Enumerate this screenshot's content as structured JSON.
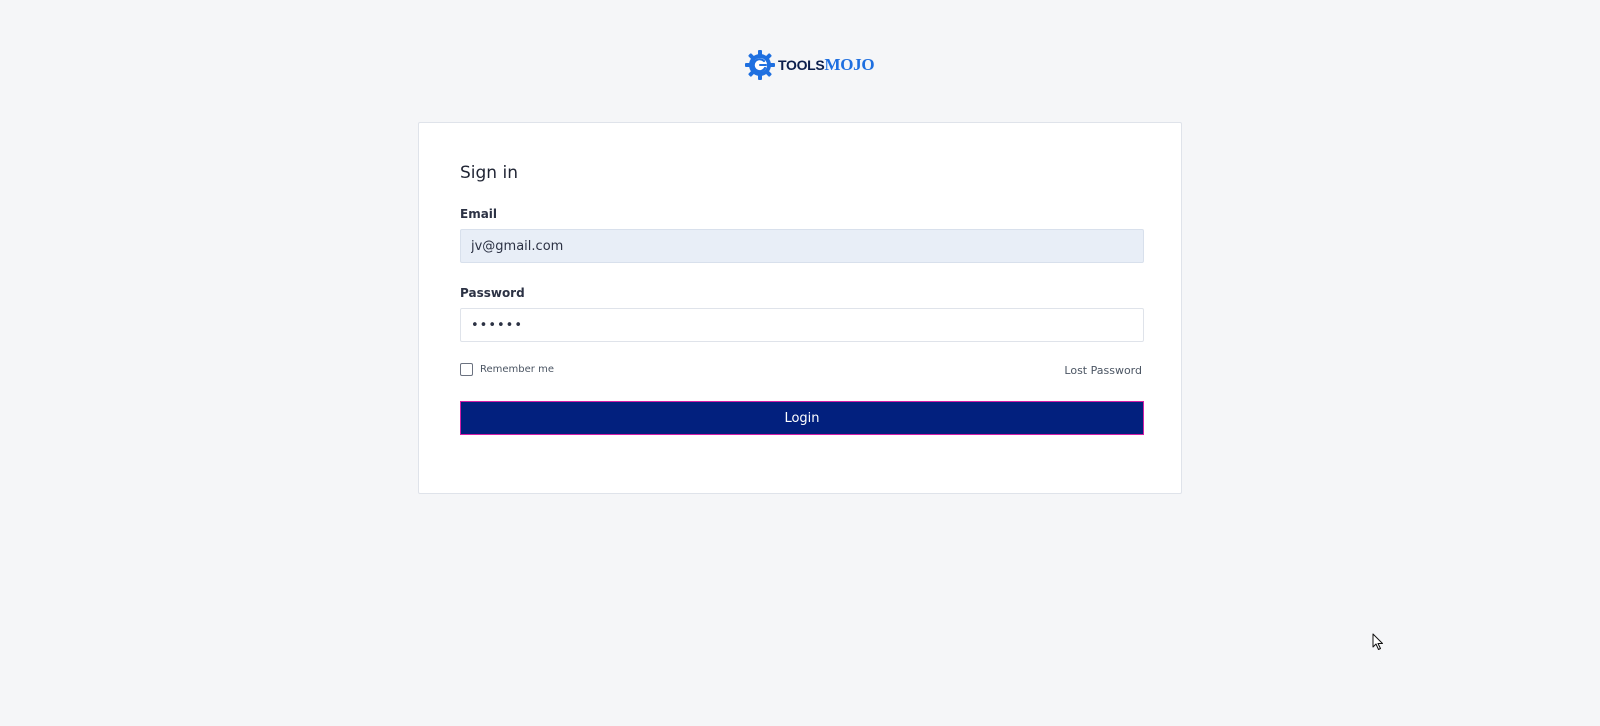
{
  "logo": {
    "part1": "TOOLS",
    "part2": "MOJO"
  },
  "form": {
    "title": "Sign in",
    "email_label": "Email",
    "email_value": "jv@gmail.com",
    "password_label": "Password",
    "password_value": "••••••",
    "remember_label": "Remember me",
    "remember_checked": false,
    "lost_password_label": "Lost Password",
    "login_label": "Login"
  },
  "colors": {
    "page_bg": "#f5f6f8",
    "button_bg": "#02207e",
    "button_border": "#d21fa6",
    "email_field_bg": "#e8eef7",
    "logo_blue": "#1e6fe0",
    "logo_dark": "#0b1f4d"
  },
  "icons": {
    "logo": "gear-logo-icon",
    "cursor": "mouse-pointer-icon"
  }
}
